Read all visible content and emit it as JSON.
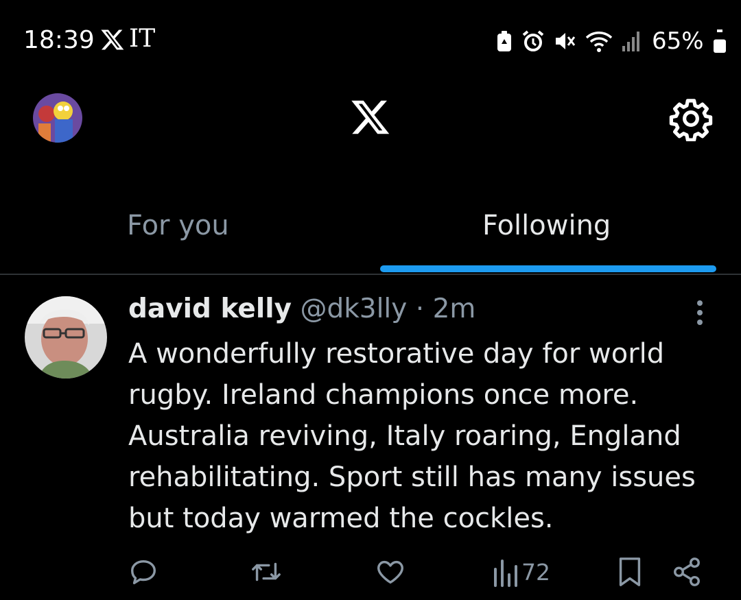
{
  "status_bar": {
    "time": "18:39",
    "carrier_text": "IT",
    "battery_percent": "65%",
    "battery_level": 0.65,
    "icons": [
      "x-logo-icon",
      "battery-saver-icon",
      "alarm-icon",
      "mute-icon",
      "wifi-icon",
      "signal-icon",
      "battery-icon"
    ]
  },
  "header": {
    "logo_icon": "x-logo-icon",
    "settings_icon": "gear-icon"
  },
  "tabs": [
    {
      "label": "For you",
      "active": false
    },
    {
      "label": "Following",
      "active": true
    }
  ],
  "colors": {
    "accent": "#1d9bf0",
    "background": "#000000",
    "text": "#e7e9ea",
    "muted": "#8b98a5"
  },
  "tweet": {
    "author_name": "david kelly",
    "handle": "@dk3lly",
    "separator": "·",
    "time_ago": "2m",
    "lines": [
      "A wonderfully restorative day for world",
      "rugby. Ireland champions once more.",
      "Australia reviving, Italy roaring, England",
      "rehabilitating. Sport still has many issues",
      "but today warmed the cockles."
    ],
    "actions": {
      "views_count": "72",
      "icons": [
        "reply-icon",
        "retweet-icon",
        "like-icon",
        "views-icon",
        "bookmark-icon",
        "share-icon"
      ]
    }
  }
}
